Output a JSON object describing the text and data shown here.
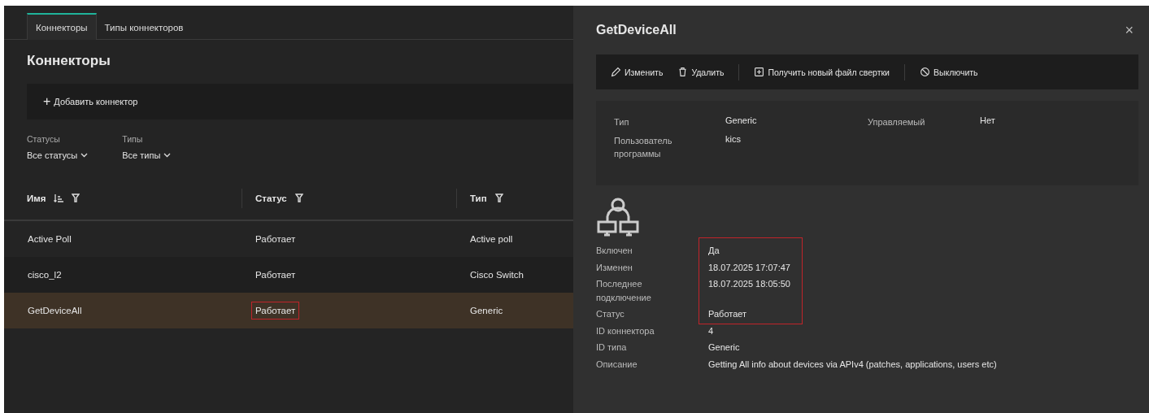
{
  "tabs": [
    {
      "label": "Коннекторы",
      "selected": true
    },
    {
      "label": "Типы коннекторов",
      "selected": false
    }
  ],
  "page_title": "Коннекторы",
  "add_button": {
    "icon": "+",
    "label": "Добавить коннектор"
  },
  "filters": [
    {
      "label": "Статусы",
      "value": "Все статусы"
    },
    {
      "label": "Типы",
      "value": "Все типы"
    }
  ],
  "table": {
    "columns": [
      {
        "label": "Имя",
        "sortable": true
      },
      {
        "label": "Статус",
        "sortable": false
      },
      {
        "label": "Тип",
        "sortable": false
      }
    ],
    "rows": [
      {
        "selected": false,
        "cells": [
          {
            "text": "Active Poll",
            "highlighted": false
          },
          {
            "text": "Работает",
            "highlighted": false
          },
          {
            "text": "Active poll",
            "highlighted": false
          }
        ]
      },
      {
        "selected": false,
        "cells": [
          {
            "text": "cisco_l2",
            "highlighted": false
          },
          {
            "text": "Работает",
            "highlighted": false
          },
          {
            "text": "Cisco Switch",
            "highlighted": false
          }
        ]
      },
      {
        "selected": true,
        "cells": [
          {
            "text": "GetDeviceAll",
            "highlighted": false
          },
          {
            "text": "Работает",
            "highlighted": true
          },
          {
            "text": "Generic",
            "highlighted": false
          }
        ]
      }
    ]
  },
  "details": {
    "title": "GetDeviceAll",
    "close": "×",
    "actions": [
      {
        "kind": "edit",
        "label": "Изменить"
      },
      {
        "kind": "delete",
        "label": "Удалить"
      },
      {
        "kind": "separator"
      },
      {
        "kind": "download",
        "label": "Получить новый файл свертки"
      },
      {
        "kind": "separator"
      },
      {
        "kind": "disable",
        "label": "Выключить"
      }
    ],
    "summary": [
      {
        "label": "Тип",
        "value": "Generic"
      },
      {
        "label": "Управляемый",
        "value": "Нет"
      },
      {
        "label": "Пользователь программы",
        "value": "kics"
      }
    ],
    "sections": [
      {
        "highlighted": true,
        "rows": [
          {
            "label": "Включен",
            "value": "Да"
          },
          {
            "label": "Изменен",
            "value": "18.07.2025 17:07:47"
          },
          {
            "label": "Последнее подключение",
            "value": "18.07.2025 18:05:50"
          },
          {
            "label": "Статус",
            "value": "Работает"
          }
        ]
      },
      {
        "highlighted": false,
        "rows": [
          {
            "label": "ID коннектора",
            "value": "4"
          },
          {
            "label": "ID типа",
            "value": "Generic"
          },
          {
            "label": "Описание",
            "value": "Getting All info about devices via APIv4 (patches, applications, users etc)"
          }
        ]
      }
    ]
  }
}
